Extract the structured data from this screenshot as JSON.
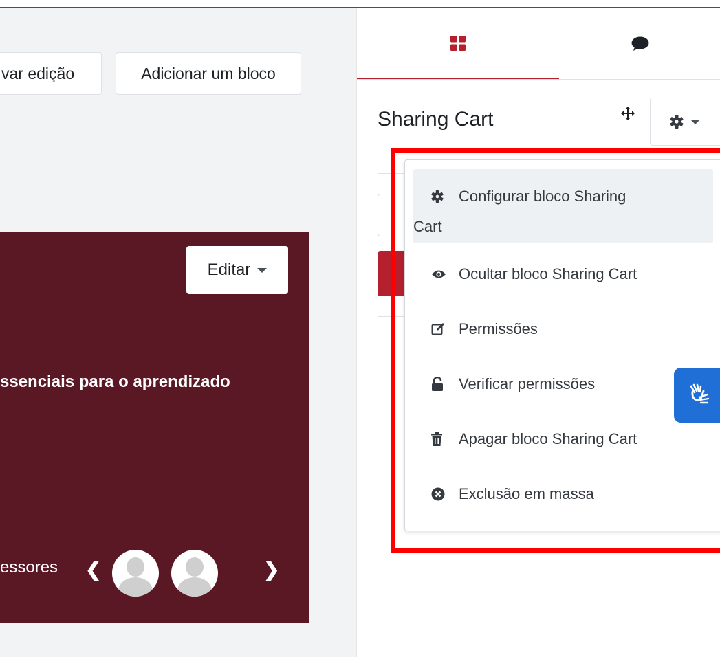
{
  "toolbar": {
    "toggle_edit_label": "var edição",
    "add_block_label": "Adicionar um bloco"
  },
  "course_card": {
    "edit_label": "Editar",
    "heading": "ssenciais para o aprendizado",
    "teachers_label": "essores"
  },
  "drawer": {
    "tabs": [
      {
        "icon": "blocks-grid-icon"
      },
      {
        "icon": "chat-bubble-icon"
      }
    ],
    "block_title": "Sharing Cart",
    "menu": {
      "items": [
        {
          "icon": "gear-icon",
          "label_line1": "Configurar bloco Sharing",
          "label_line2": "Cart"
        },
        {
          "icon": "eye-icon",
          "label": "Ocultar bloco Sharing Cart"
        },
        {
          "icon": "edit-icon",
          "label": "Permissões"
        },
        {
          "icon": "unlock-icon",
          "label": "Verificar permissões"
        },
        {
          "icon": "trash-icon",
          "label": "Apagar bloco Sharing Cart"
        },
        {
          "icon": "x-circle-icon",
          "label": "Exclusão em massa"
        }
      ]
    }
  },
  "colors": {
    "accent": "#b5202e",
    "course_card_bg": "#5a1724",
    "highlight": "#ff0000",
    "a11y_widget": "#1f6fd6"
  }
}
